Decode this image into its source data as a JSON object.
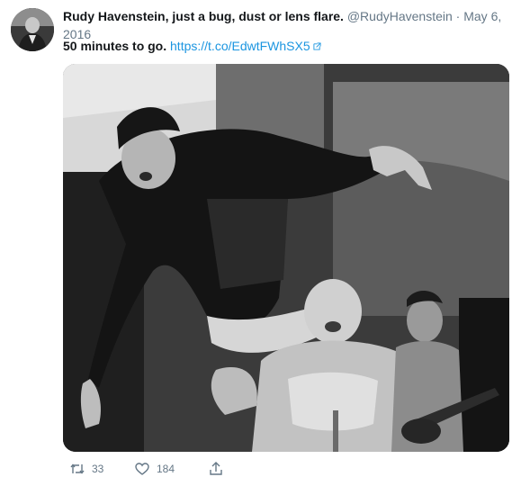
{
  "tweet": {
    "author_name": "Rudy Havenstein, just a bug, dust or lens flare.",
    "handle": "@RudyHavenstein",
    "separator": "·",
    "date": "May 6, 2016",
    "text": "50 minutes to go.",
    "link": "https://t.co/EdwtFWhSX5",
    "media_icon": "photo",
    "avatar_icon": "profile-photo"
  },
  "actions": {
    "retweet_icon": "retweet-icon",
    "retweet_count": "33",
    "like_icon": "heart-icon",
    "like_count": "184",
    "share_icon": "share-icon"
  },
  "colors": {
    "link": "#1b95e0",
    "secondary_text": "#657786",
    "primary_text": "#14171a"
  }
}
